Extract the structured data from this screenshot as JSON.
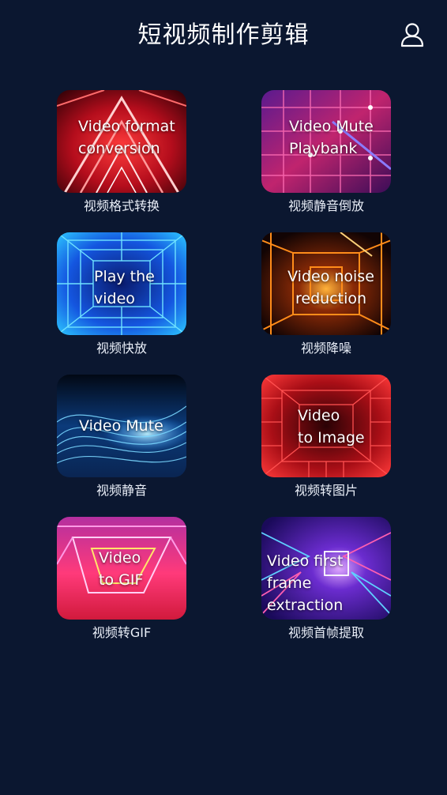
{
  "header": {
    "title": "短视频制作剪辑",
    "profile_icon": "user-icon"
  },
  "colors": {
    "background": "#0b1730",
    "text": "#ffffff",
    "label": "#e9eef7"
  },
  "tools": [
    {
      "thumb_text": "Video format\nconversion",
      "label": "视频格式转换"
    },
    {
      "thumb_text": "Video Mute\nPlaybank",
      "label": "视频静音倒放"
    },
    {
      "thumb_text": "Play the\nvideo",
      "label": "视频快放"
    },
    {
      "thumb_text": "Video noise\nreduction",
      "label": "视频降噪"
    },
    {
      "thumb_text": "Video Mute",
      "label": "视频静音"
    },
    {
      "thumb_text": "Video\nto Image",
      "label": "视频转图片"
    },
    {
      "thumb_text": "Video\nto GIF",
      "label": "视频转GIF"
    },
    {
      "thumb_text": "Video first\nframe extraction",
      "label": "视频首帧提取"
    }
  ]
}
